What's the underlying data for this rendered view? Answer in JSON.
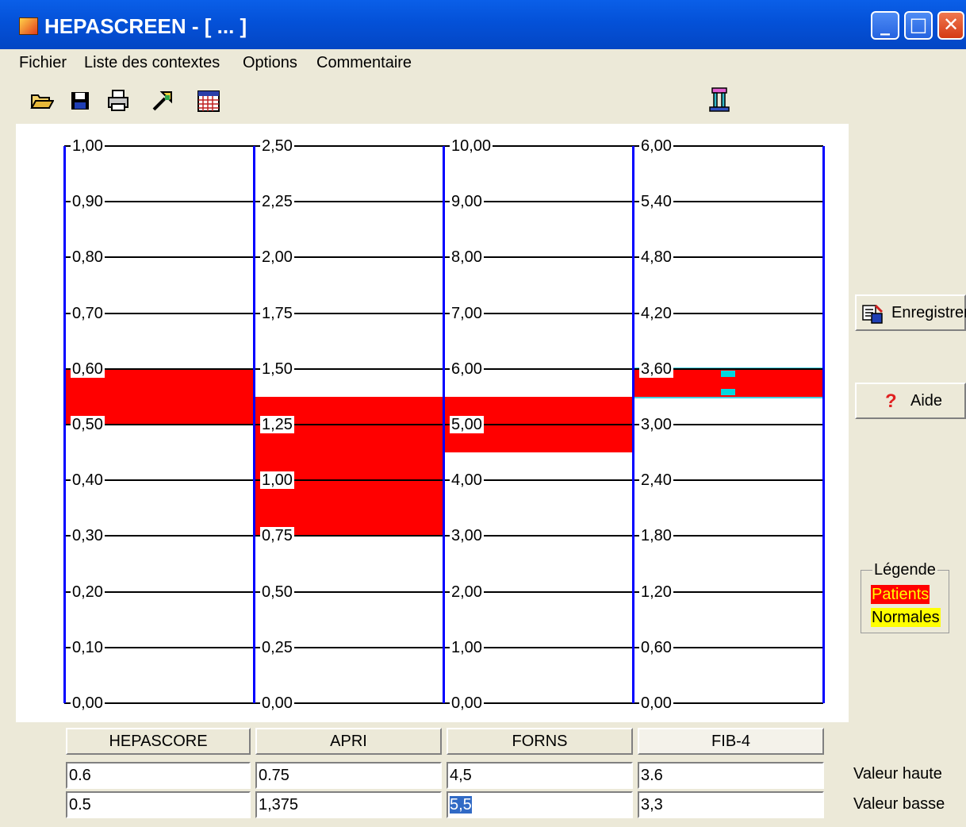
{
  "window": {
    "title": "HEPASCREEN - [ ... ]",
    "min_glyph": "_",
    "max_glyph": "□",
    "close_glyph": "✕"
  },
  "menu": [
    "Fichier",
    "Liste des contextes",
    "Options",
    "Commentaire"
  ],
  "toolbar": [
    "open-folder-icon",
    "save-disk-icon",
    "printer-icon",
    "wand-icon",
    "calendar-grid-icon",
    "tuning-fork-icon"
  ],
  "columns": [
    {
      "name": "HEPASCORE",
      "ticks": [
        "1,00",
        "0,90",
        "0,80",
        "0,70",
        "0,60",
        "0,50",
        "0,40",
        "0,30",
        "0,20",
        "0,10",
        "0,00"
      ],
      "max": 1.0,
      "band": [
        0.5,
        0.6
      ],
      "valeur_haute": "0.6",
      "valeur_basse": "0.5"
    },
    {
      "name": "APRI",
      "ticks": [
        "2,50",
        "2,25",
        "2,00",
        "1,75",
        "1,50",
        "1,25",
        "1,00",
        "0,75",
        "0,50",
        "0,25",
        "0,00"
      ],
      "max": 2.5,
      "band": [
        0.75,
        1.375
      ],
      "valeur_haute": "0.75",
      "valeur_basse": "1,375"
    },
    {
      "name": "FORNS",
      "ticks": [
        "10,00",
        "9,00",
        "8,00",
        "7,00",
        "6,00",
        "5,00",
        "4,00",
        "3,00",
        "2,00",
        "1,00",
        "0,00"
      ],
      "max": 10.0,
      "band": [
        4.5,
        5.5
      ],
      "valeur_haute": "4,5",
      "valeur_basse": "5,5"
    },
    {
      "name": "FIB-4",
      "ticks": [
        "6,00",
        "5,40",
        "4,80",
        "4,20",
        "3,60",
        "3,00",
        "2,40",
        "1,80",
        "1,20",
        "0,60",
        "0,00"
      ],
      "max": 6.0,
      "band": [
        3.3,
        3.6
      ],
      "valeur_haute": "3.6",
      "valeur_basse": "3,3"
    }
  ],
  "row_labels": {
    "haute": "Valeur haute",
    "basse": "Valeur basse"
  },
  "buttons": {
    "enregistrer": "Enregistrer",
    "aide": "Aide"
  },
  "legend": {
    "title": "Légende",
    "patients": "Patients",
    "normales": "Normales",
    "patients_color": "#ff0000",
    "normales_color": "#ffff00"
  },
  "colors": {
    "title_bar": "#0451d8",
    "axis": "#0000ff",
    "band": "#ff0000",
    "handle": "#00d8e0"
  }
}
